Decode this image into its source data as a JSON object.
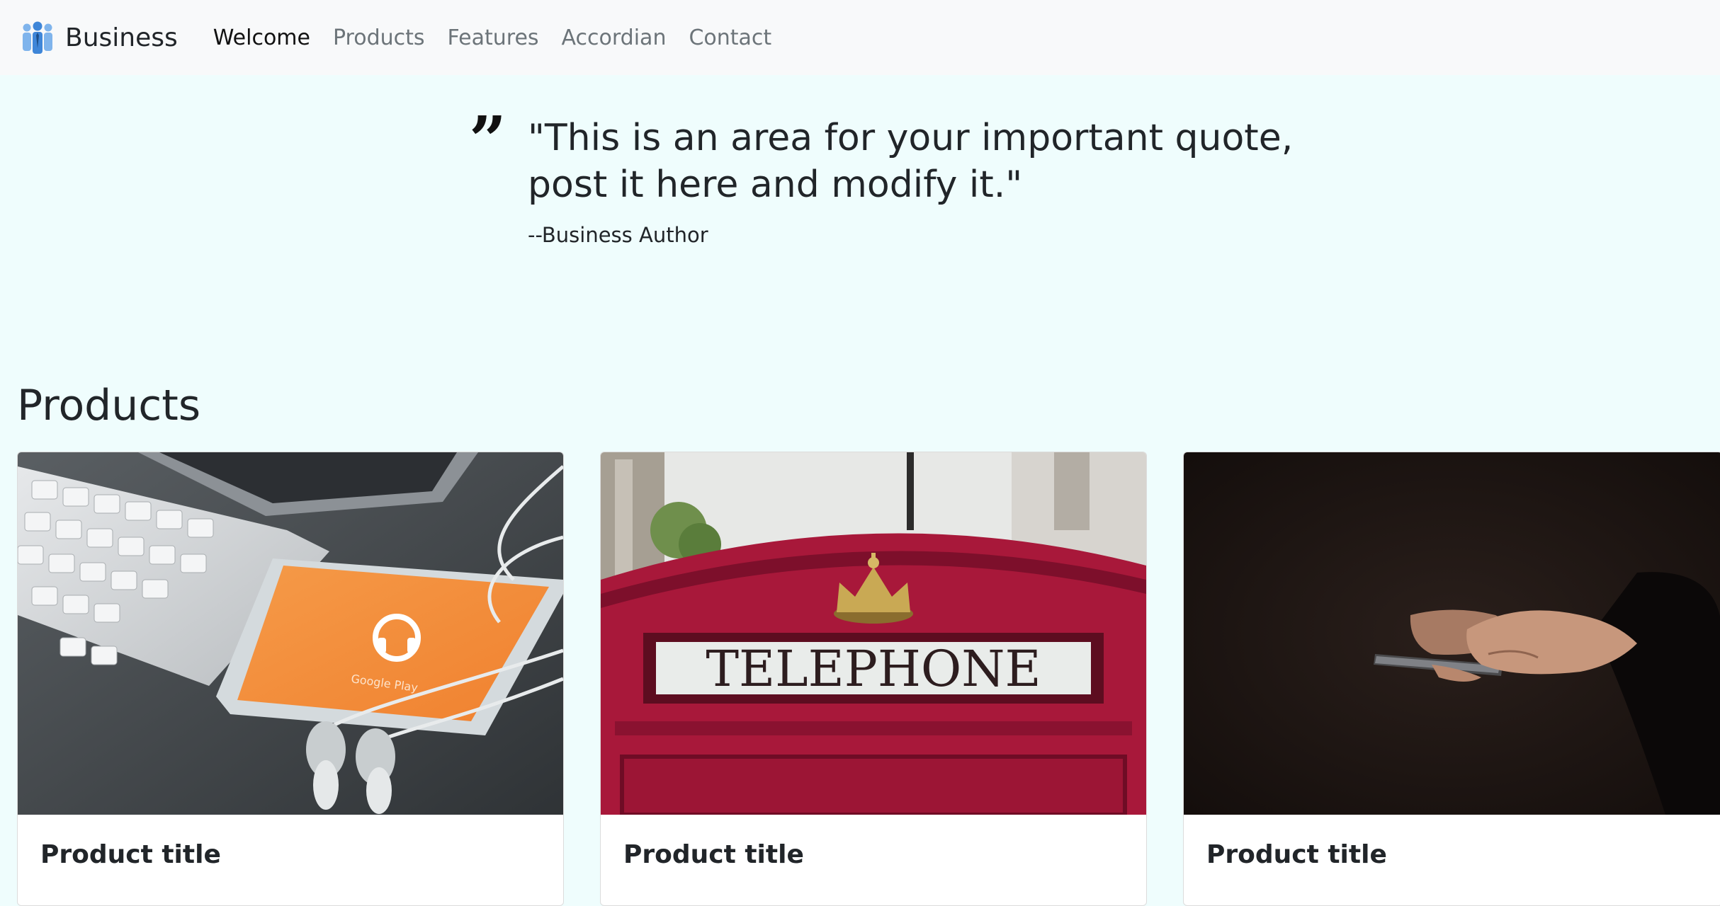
{
  "navbar": {
    "brand": "Business",
    "links": [
      {
        "label": "Welcome",
        "active": true
      },
      {
        "label": "Products",
        "active": false
      },
      {
        "label": "Features",
        "active": false
      },
      {
        "label": "Accordian",
        "active": false
      },
      {
        "label": "Contact",
        "active": false
      }
    ]
  },
  "quote": {
    "mark": "”",
    "text": "\"This is an area for your important quote, post it here and modify it.\"",
    "author": "--Business Author"
  },
  "products": {
    "title": "Products",
    "cards": [
      {
        "title": "Product title",
        "image_icon": "phone-keyboard-earbuds-photo",
        "phone_text": "Google Play"
      },
      {
        "title": "Product title",
        "image_icon": "red-telephone-box-photo",
        "sign_text": "TELEPHONE"
      },
      {
        "title": "Product title",
        "image_icon": "hands-holding-phone-photo"
      }
    ]
  },
  "colors": {
    "page_bg": "#effdfd",
    "navbar_bg": "#f8f9fa",
    "nav_text": "#6c7479",
    "brand_icon": "#4a90d9"
  }
}
